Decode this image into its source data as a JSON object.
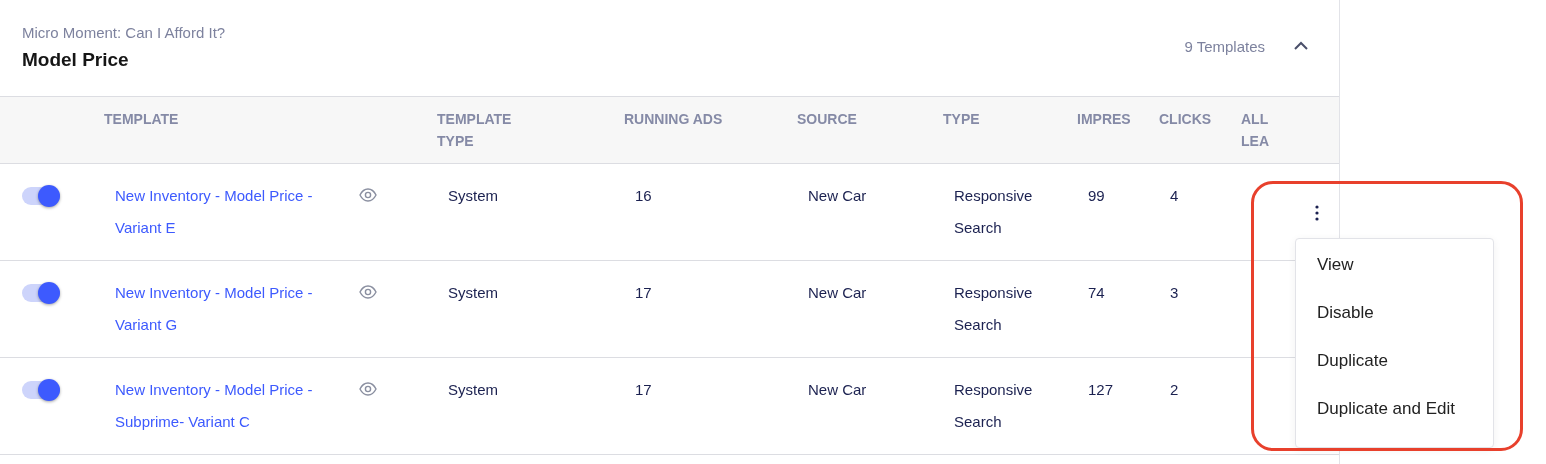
{
  "section": {
    "subtitle": "Micro Moment: Can I Afford It?",
    "title": "Model Price",
    "count": "9 Templates",
    "expanded": true
  },
  "columns": [
    "",
    "TEMPLATE",
    "TEMPLATE TYPE",
    "RUNNING ADS",
    "SOURCE",
    "TYPE",
    "IMPRES",
    "CLICKS",
    "ALL LEA"
  ],
  "rows": [
    {
      "on": true,
      "template": "New Inventory - Model Price - Variant E",
      "template_type": "System",
      "running_ads": "16",
      "source": "New Car",
      "type": "Responsive Search",
      "impressions": "99",
      "clicks": "4",
      "menu_open": true
    },
    {
      "on": true,
      "template": "New Inventory - Model Price - Variant G",
      "template_type": "System",
      "running_ads": "17",
      "source": "New Car",
      "type": "Responsive Search",
      "impressions": "74",
      "clicks": "3",
      "menu_open": false
    },
    {
      "on": true,
      "template": "New Inventory - Model Price - Subprime- Variant C",
      "template_type": "System",
      "running_ads": "17",
      "source": "New Car",
      "type": "Responsive Search",
      "impressions": "127",
      "clicks": "2",
      "menu_open": false
    }
  ],
  "menu": {
    "items": [
      "View",
      "Disable",
      "Duplicate",
      "Duplicate and Edit"
    ],
    "highlighted": true
  }
}
